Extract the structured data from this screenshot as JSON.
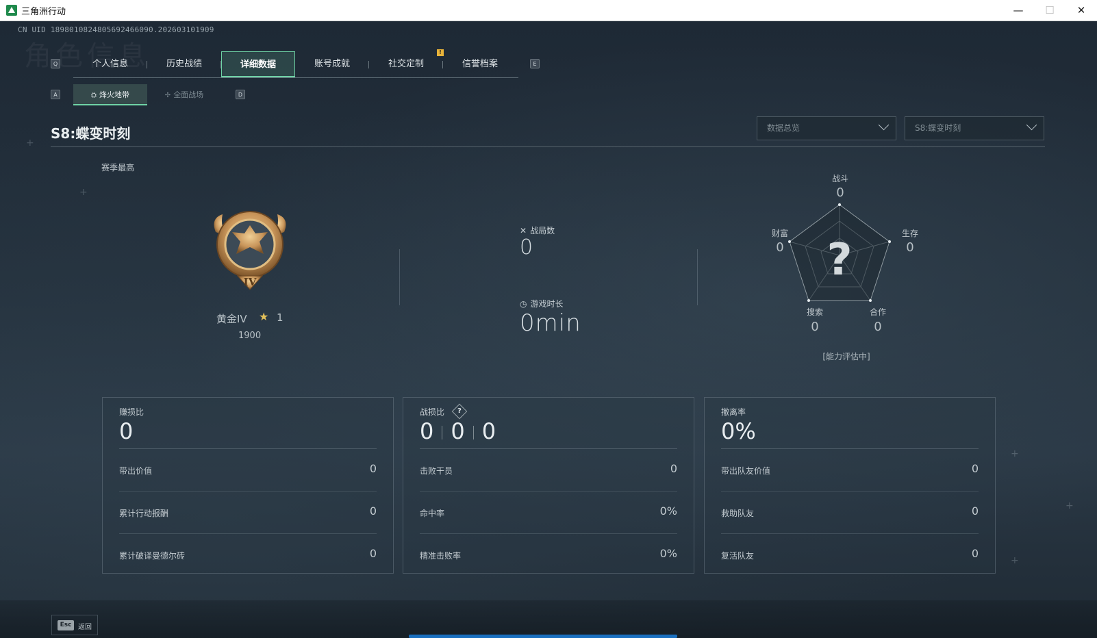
{
  "window": {
    "title": "三角洲行动",
    "min": "—",
    "max": "☐",
    "close": "✕"
  },
  "uid": "CN UID 1898010824805692466090.202603101909",
  "watermark": "角色信息",
  "keys": {
    "prev_tab": "Q",
    "next_tab": "E",
    "prev_sub": "A",
    "next_sub": "D"
  },
  "tabs": [
    "个人信息",
    "历史战绩",
    "详细数据",
    "账号成就",
    "社交定制",
    "信誉档案"
  ],
  "active_tab_index": 2,
  "notification_badge": "!",
  "subtabs": [
    {
      "label": "烽火地带",
      "icon": "⛭"
    },
    {
      "label": "全面战场",
      "icon": "✢"
    }
  ],
  "season": {
    "title": "S8:蝶变时刻"
  },
  "dropdowns": {
    "mode": "数据总览",
    "season": "S8:蝶变时刻"
  },
  "season_best_label": "赛季最高",
  "rank": {
    "name": "黄金IV",
    "stars": "1",
    "score": "1900",
    "roman": "IV",
    "badge_color": "#c8955a"
  },
  "matches": {
    "label": "战局数",
    "value": "0",
    "icon": "✕"
  },
  "playtime": {
    "label": "游戏时长",
    "value": "0min",
    "icon": "◷"
  },
  "radar": {
    "combat": {
      "label": "战斗",
      "value": "0"
    },
    "survival": {
      "label": "生存",
      "value": "0"
    },
    "cooperation": {
      "label": "合作",
      "value": "0"
    },
    "search": {
      "label": "搜索",
      "value": "0"
    },
    "wealth": {
      "label": "财富",
      "value": "0"
    },
    "center": "?",
    "evaluating": "[能力评估中]"
  },
  "cards": [
    {
      "title": "赚损比",
      "big": "0",
      "rows": [
        {
          "label": "带出价值",
          "value": "0"
        },
        {
          "label": "累计行动报酬",
          "value": "0"
        },
        {
          "label": "累计破译曼德尔砖",
          "value": "0"
        }
      ]
    },
    {
      "title": "战损比",
      "help": "?",
      "kd": [
        "0",
        "0",
        "0"
      ],
      "rows": [
        {
          "label": "击败干员",
          "value": "0"
        },
        {
          "label": "命中率",
          "value": "0%"
        },
        {
          "label": "精准击败率",
          "value": "0%"
        }
      ]
    },
    {
      "title": "撤离率",
      "big": "0%",
      "rows": [
        {
          "label": "带出队友价值",
          "value": "0"
        },
        {
          "label": "救助队友",
          "value": "0"
        },
        {
          "label": "复活队友",
          "value": "0"
        }
      ]
    }
  ],
  "back": {
    "key": "Esc",
    "label": "返回"
  },
  "colors": {
    "accent": "#6fd3a6",
    "scrollbar": "#1a6fbf"
  }
}
